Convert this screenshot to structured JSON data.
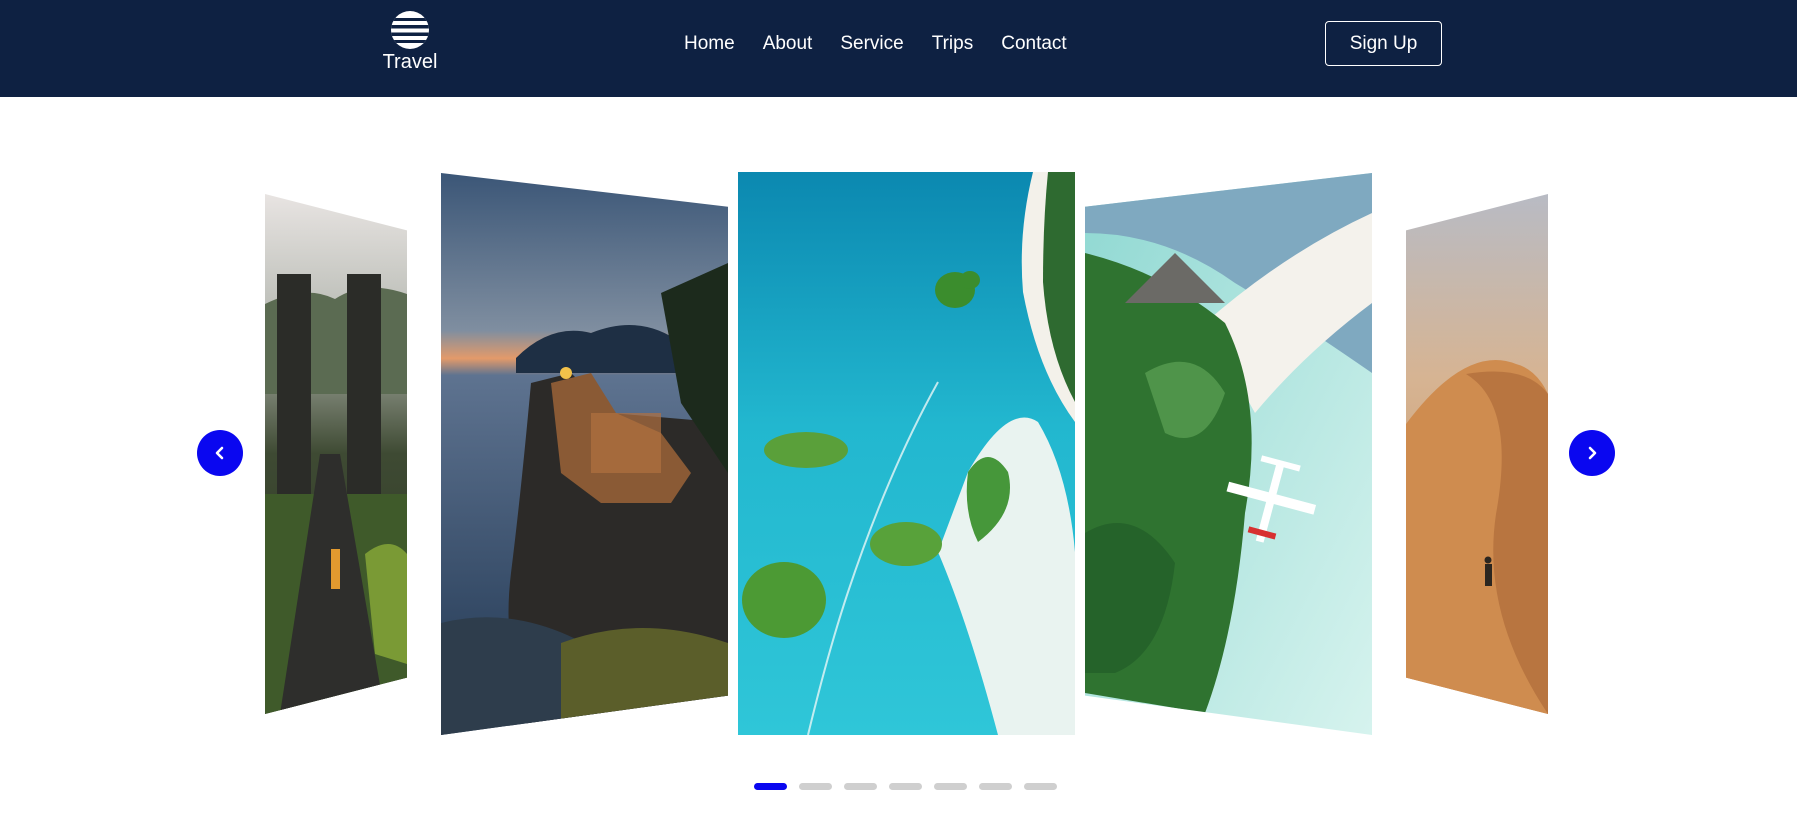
{
  "brand": {
    "name": "Travel",
    "logo_icon": "striped-globe-icon"
  },
  "nav": {
    "items": [
      "Home",
      "About",
      "Service",
      "Trips",
      "Contact"
    ],
    "signup_label": "Sign Up"
  },
  "carousel": {
    "slides": [
      {
        "scene": "temple-gate-path"
      },
      {
        "scene": "coastal-village-dusk"
      },
      {
        "scene": "aerial-islands-turquoise"
      },
      {
        "scene": "tropical-beach-seaplane"
      },
      {
        "scene": "desert-dunes"
      }
    ],
    "prev_icon": "chevron-left-icon",
    "next_icon": "chevron-right-icon",
    "dot_count": 7,
    "active_index": 0
  },
  "colors": {
    "nav_bg": "#0e2142",
    "accent": "#0a07f0",
    "dot_inactive": "#cfcfcf"
  }
}
